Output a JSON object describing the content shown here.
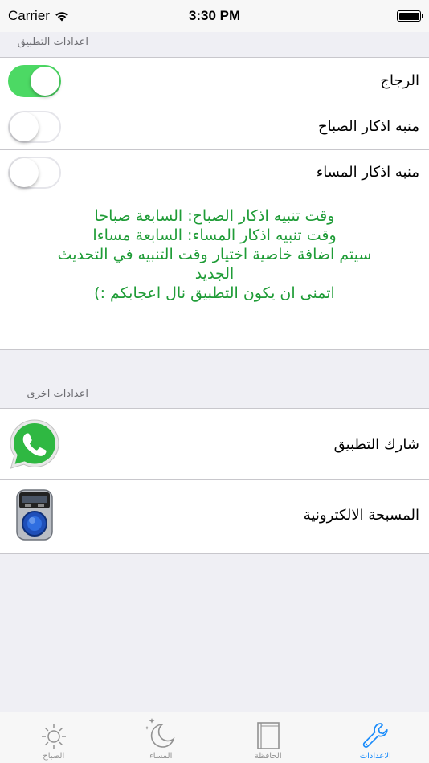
{
  "status_bar": {
    "carrier": "Carrier",
    "time": "3:30 PM"
  },
  "section_app": {
    "title": "اعدادات التطبيق"
  },
  "settings": [
    {
      "label": "الرجاج",
      "on": true
    },
    {
      "label": "منبه اذكار الصباح",
      "on": false
    },
    {
      "label": "منبه اذكار المساء",
      "on": false
    }
  ],
  "info_lines": [
    "وقت تنبيه اذكار الصباح: السابعة صباحا",
    "وقت تنبيه اذكار المساء: السابعة مساءا",
    "سيتم اضافة خاصية اختيار وقت التنبيه في التحديث",
    "الجديد",
    "اتمنى ان يكون التطبيق نال اعجابكم :)"
  ],
  "section_other": {
    "title": "اعدادات اخرى"
  },
  "other_items": [
    {
      "label": "شارك التطبيق",
      "icon": "whatsapp-icon"
    },
    {
      "label": "المسبحة الالكترونية",
      "icon": "tally-counter-icon"
    }
  ],
  "tabs": [
    {
      "label": "الصباح",
      "icon": "sun-icon"
    },
    {
      "label": "المساء",
      "icon": "moon-icon"
    },
    {
      "label": "الحافظة",
      "icon": "book-icon"
    },
    {
      "label": "الاعدادات",
      "icon": "wrench-icon",
      "active": true
    }
  ],
  "colors": {
    "accent": "#1b8cfa",
    "toggle_on": "#4cd964",
    "info_text": "#1f9c37"
  }
}
